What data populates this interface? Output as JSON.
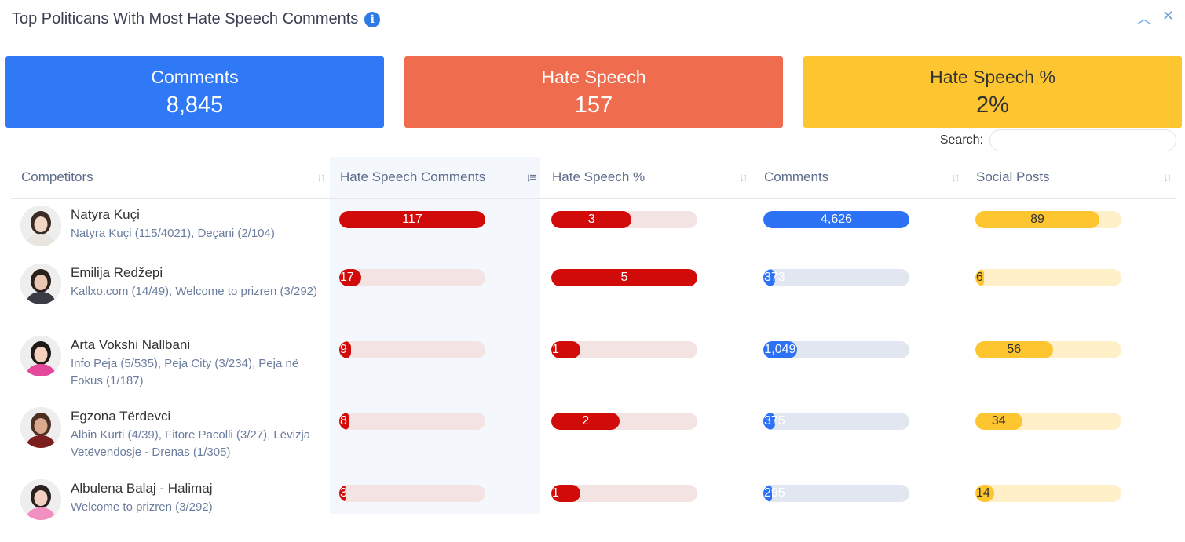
{
  "header": {
    "title": "Top Politicans With Most Hate Speech Comments",
    "collapse_icon": "chevron-up-icon",
    "close_icon": "close-icon"
  },
  "summary": [
    {
      "label": "Comments",
      "value": "8,845",
      "color": "#2f79f6"
    },
    {
      "label": "Hate Speech",
      "value": "157",
      "color": "#ef6c4f"
    },
    {
      "label": "Hate Speech %",
      "value": "2%",
      "color": "#fdc530"
    }
  ],
  "search": {
    "label": "Search:",
    "placeholder": ""
  },
  "columns": [
    "Competitors",
    "Hate Speech Comments",
    "Hate Speech %",
    "Comments",
    "Social Posts"
  ],
  "rows": [
    {
      "name": "Natyra Kuçi",
      "sources": "Natyra Kuçi (115/4021), Deçani (2/104)",
      "hate_comments": {
        "value": 117,
        "label": "117",
        "fraction": 1.0
      },
      "hate_pct": {
        "value": 3,
        "label": "3",
        "fraction": 0.55
      },
      "comments": {
        "value": 4626,
        "label": "4,626",
        "fraction": 1.0
      },
      "posts": {
        "value": 89,
        "label": "89",
        "fraction": 0.85
      }
    },
    {
      "name": "Emilija Redžepi",
      "sources": "Kallxo.com (14/49), Welcome to prizren (3/292)",
      "hate_comments": {
        "value": 17,
        "label": "17",
        "fraction": 0.15
      },
      "hate_pct": {
        "value": 5,
        "label": "5",
        "fraction": 1.0
      },
      "comments": {
        "value": 373,
        "label": "373",
        "fraction": 0.08
      },
      "posts": {
        "value": 6,
        "label": "6",
        "fraction": 0.06
      }
    },
    {
      "name": "Arta Vokshi Nallbani",
      "sources": "Info Peja (5/535), Peja City (3/234), Peja në Fokus (1/187)",
      "hate_comments": {
        "value": 9,
        "label": "9",
        "fraction": 0.08
      },
      "hate_pct": {
        "value": 1,
        "label": "1",
        "fraction": 0.2
      },
      "comments": {
        "value": 1049,
        "label": "1,049",
        "fraction": 0.23
      },
      "posts": {
        "value": 56,
        "label": "56",
        "fraction": 0.53
      }
    },
    {
      "name": "Egzona Tërdevci",
      "sources": "Albin Kurti (4/39), Fitore Pacolli (3/27), Lëvizja Vetëvendosje - Drenas (1/305)",
      "hate_comments": {
        "value": 8,
        "label": "8",
        "fraction": 0.07
      },
      "hate_pct": {
        "value": 2,
        "label": "2",
        "fraction": 0.47
      },
      "comments": {
        "value": 375,
        "label": "375",
        "fraction": 0.08
      },
      "posts": {
        "value": 34,
        "label": "34",
        "fraction": 0.32
      }
    },
    {
      "name": "Albulena Balaj - Halimaj",
      "sources": "Welcome to prizren (3/292)",
      "hate_comments": {
        "value": 3,
        "label": "3",
        "fraction": 0.03
      },
      "hate_pct": {
        "value": 1,
        "label": "1",
        "fraction": 0.2
      },
      "comments": {
        "value": 295,
        "label": "295",
        "fraction": 0.06
      },
      "posts": {
        "value": 14,
        "label": "14",
        "fraction": 0.13
      }
    }
  ]
}
